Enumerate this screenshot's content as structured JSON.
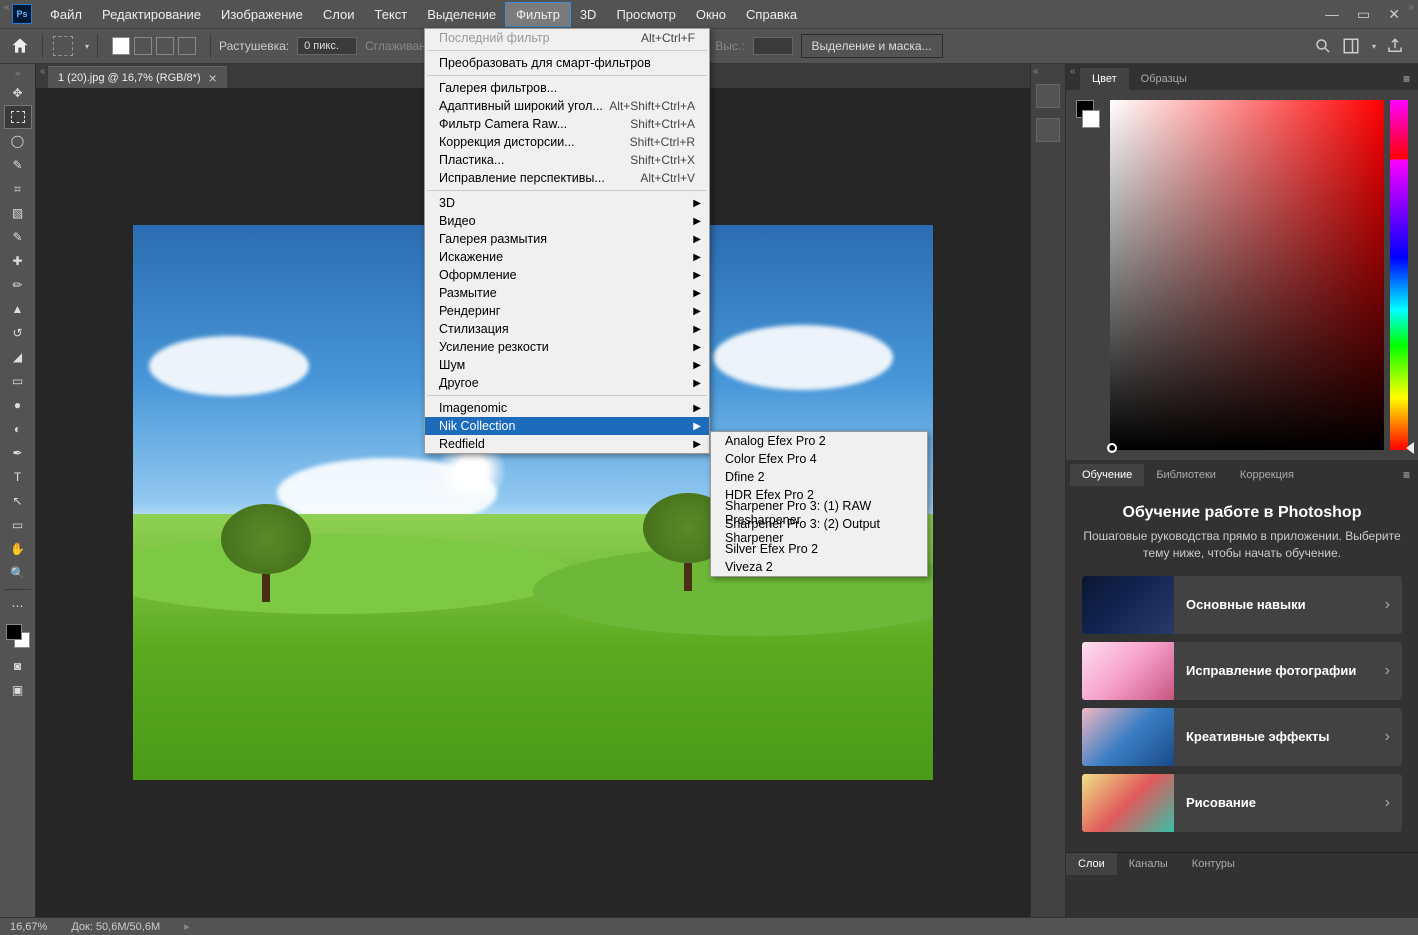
{
  "menubar": [
    "Файл",
    "Редактирование",
    "Изображение",
    "Слои",
    "Текст",
    "Выделение",
    "Фильтр",
    "3D",
    "Просмотр",
    "Окно",
    "Справка"
  ],
  "menubar_active_index": 6,
  "optbar": {
    "feather_label": "Растушевка:",
    "feather_value": "0 пикс.",
    "antialias": "Сглаживание",
    "height_lbl": "Выс.:",
    "selectmask": "Выделение и маска..."
  },
  "document_tab": "1 (20).jpg @ 16,7% (RGB/8*)",
  "filter_menu": {
    "last_filter": {
      "l": "Последний фильтр",
      "s": "Alt+Ctrl+F"
    },
    "smart": "Преобразовать для смарт-фильтров",
    "gallery": "Галерея фильтров...",
    "adaptive": {
      "l": "Адаптивный широкий угол...",
      "s": "Alt+Shift+Ctrl+A"
    },
    "cameraraw": {
      "l": "Фильтр Camera Raw...",
      "s": "Shift+Ctrl+A"
    },
    "lens": {
      "l": "Коррекция дисторсии...",
      "s": "Shift+Ctrl+R"
    },
    "liquify": {
      "l": "Пластика...",
      "s": "Shift+Ctrl+X"
    },
    "vanish": {
      "l": "Исправление перспективы...",
      "s": "Alt+Ctrl+V"
    },
    "sub_groups": [
      "3D",
      "Видео",
      "Галерея размытия",
      "Искажение",
      "Оформление",
      "Размытие",
      "Рендеринг",
      "Стилизация",
      "Усиление резкости",
      "Шум",
      "Другое"
    ],
    "plugins": [
      "Imagenomic",
      "Nik Collection",
      "Redfield"
    ],
    "plugin_active_index": 1
  },
  "nik_submenu": [
    "Analog Efex Pro 2",
    "Color Efex Pro 4",
    "Dfine 2",
    "HDR Efex Pro 2",
    "Sharpener Pro 3: (1) RAW Presharpener",
    "Sharpener Pro 3: (2) Output Sharpener",
    "Silver Efex Pro 2",
    "Viveza 2"
  ],
  "right_panels": {
    "color_tabs": [
      "Цвет",
      "Образцы"
    ],
    "learn_tabs": [
      "Обучение",
      "Библиотеки",
      "Коррекция"
    ],
    "learn_title": "Обучение работе в Photoshop",
    "learn_sub": "Пошаговые руководства прямо в приложении. Выберите тему ниже, чтобы начать обучение.",
    "cards": [
      "Основные навыки",
      "Исправление фотографии",
      "Креативные эффекты",
      "Рисование"
    ],
    "bottom_tabs": [
      "Слои",
      "Каналы",
      "Контуры"
    ]
  },
  "statusbar": {
    "zoom": "16,67%",
    "doc": "Док: 50,6M/50,6M"
  },
  "card_thumbs": [
    "linear-gradient(135deg,#0a1530,#142655 50%,#2a3a6a)",
    "linear-gradient(135deg,#ffdff0,#f59fc9 50%,#c8557f)",
    "linear-gradient(135deg,#f0b8c2,#3a7ec4 50%,#1a4a88)",
    "linear-gradient(135deg,#f0e088,#e05a5a 50%,#3abfa8)"
  ]
}
